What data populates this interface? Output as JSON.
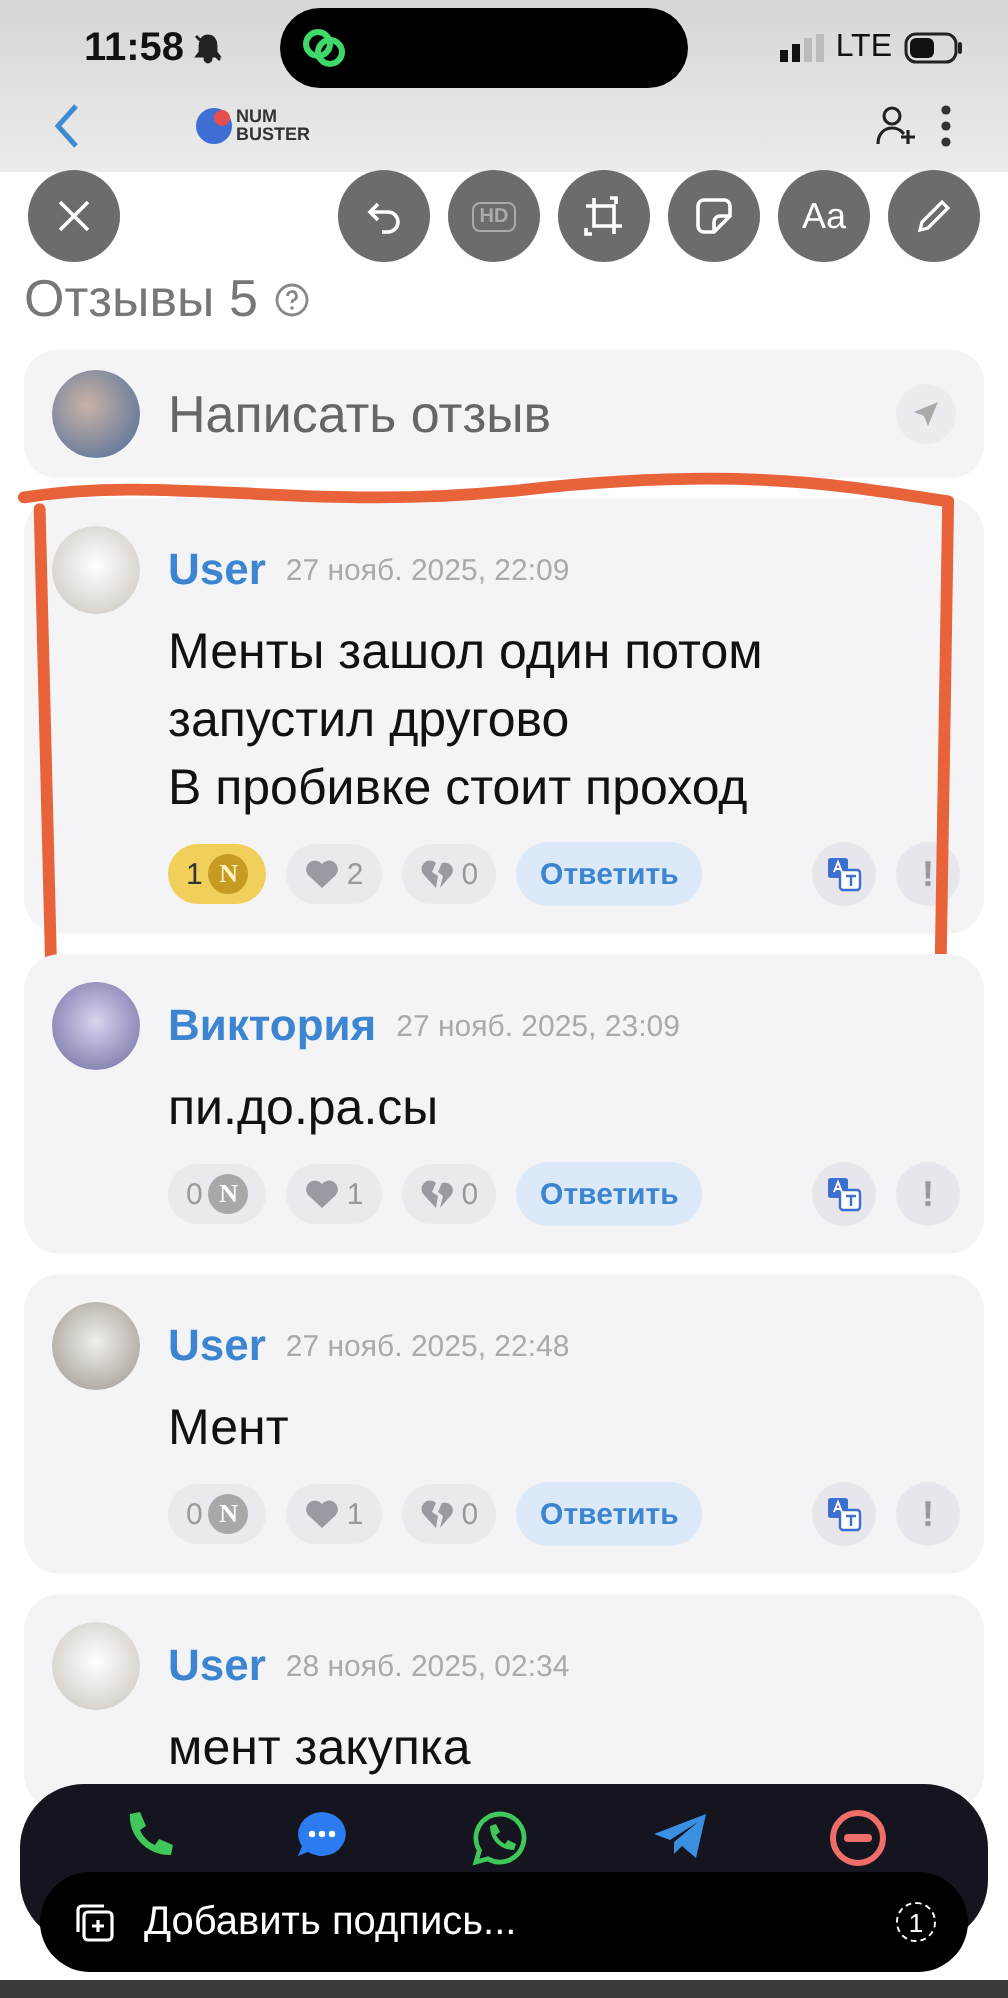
{
  "status_bar": {
    "time": "11:58",
    "network": "LTE"
  },
  "app_bar": {
    "logo_top": "NUM",
    "logo_bottom": "BUSTER"
  },
  "editor_toolbar": {
    "tools": [
      {
        "kind": "undo"
      },
      {
        "kind": "hd",
        "label": "HD"
      },
      {
        "kind": "crop"
      },
      {
        "kind": "sticker"
      },
      {
        "kind": "text",
        "label": "Aa"
      },
      {
        "kind": "pen"
      }
    ]
  },
  "reviews_header": {
    "title": "Отзывы",
    "count": "5"
  },
  "composer": {
    "placeholder": "Написать отзыв"
  },
  "reviews": [
    {
      "author": "User",
      "date": "27 нояб. 2025, 22:09",
      "text": "Менты зашол один потом\nзапустил другово\nВ пробивке стоит проход",
      "highlighted": true,
      "actions": {
        "coins": "1",
        "coin_mark": "N",
        "coin_active": true,
        "likes": "2",
        "dislikes": "0",
        "reply": "Ответить",
        "report": "!"
      }
    },
    {
      "author": "Виктория",
      "date": "27 нояб. 2025, 23:09",
      "text": "пи.до.ра.сы",
      "highlighted": false,
      "actions": {
        "coins": "0",
        "coin_mark": "N",
        "coin_active": false,
        "likes": "1",
        "dislikes": "0",
        "reply": "Ответить",
        "report": "!"
      }
    },
    {
      "author": "User",
      "date": "27 нояб. 2025, 22:48",
      "text": "Мент",
      "highlighted": false,
      "actions": {
        "coins": "0",
        "coin_mark": "N",
        "coin_active": false,
        "likes": "1",
        "dislikes": "0",
        "reply": "Ответить",
        "report": "!"
      }
    },
    {
      "author": "User",
      "date": "28 нояб. 2025, 02:34",
      "text": "мент закупка",
      "highlighted": false
    }
  ],
  "share_bar": {
    "targets": [
      {
        "kind": "phone"
      },
      {
        "kind": "message"
      },
      {
        "kind": "whatsapp"
      },
      {
        "kind": "telegram"
      },
      {
        "kind": "block"
      }
    ]
  },
  "caption_bar": {
    "placeholder": "Добавить подпись...",
    "counter": "1"
  }
}
